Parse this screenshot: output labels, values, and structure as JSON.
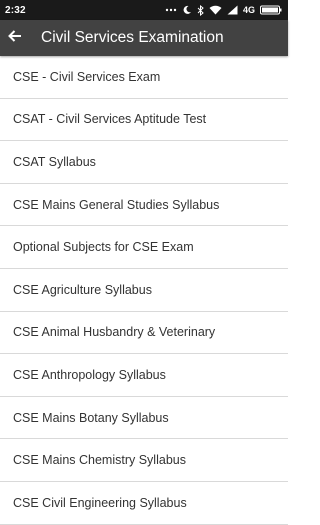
{
  "status_bar": {
    "time": "2:32",
    "network": "4G",
    "icons": [
      "dots-icon",
      "moon-icon",
      "bluetooth-icon",
      "wifi-icon",
      "signal-icon",
      "battery-icon"
    ]
  },
  "app_bar": {
    "title": "Civil Services Examination",
    "back_icon": "back-arrow-icon",
    "background": "#424242"
  },
  "list": {
    "items": [
      {
        "label": "CSE - Civil Services Exam"
      },
      {
        "label": "CSAT - Civil Services Aptitude Test"
      },
      {
        "label": "CSAT Syllabus"
      },
      {
        "label": "CSE Mains General Studies Syllabus"
      },
      {
        "label": "Optional Subjects for CSE Exam"
      },
      {
        "label": "CSE Agriculture Syllabus"
      },
      {
        "label": "CSE Animal Husbandry & Veterinary"
      },
      {
        "label": "CSE Anthropology Syllabus"
      },
      {
        "label": "CSE Mains Botany Syllabus"
      },
      {
        "label": "CSE Mains Chemistry Syllabus"
      },
      {
        "label": "CSE Civil Engineering Syllabus"
      }
    ]
  }
}
